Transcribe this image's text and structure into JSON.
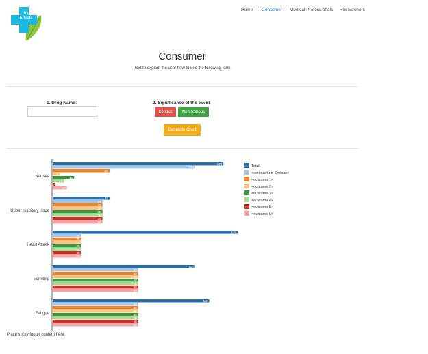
{
  "brand": {
    "logo_text_line1": "Rx",
    "logo_text_line2": "Effects",
    "accent_blue": "#1fb8e0",
    "accent_green": "#8cc63f"
  },
  "nav": {
    "items": [
      {
        "label": "Home",
        "active": false
      },
      {
        "label": "Consumer",
        "active": true
      },
      {
        "label": "Medical Professionals",
        "active": false
      },
      {
        "label": "Researchers",
        "active": false
      }
    ]
  },
  "page": {
    "title": "Consumer",
    "subtitle": "Text to explain the user how to use the following form"
  },
  "form": {
    "drug_label": "1. Drug Name:",
    "drug_value": "",
    "significance_label": "2. Significance of the event",
    "serious_label": "Serious",
    "nonserious_label": "Non-Serious",
    "generate_label": "Generate Chart",
    "colors": {
      "serious": "#d9534f",
      "nonserious": "#43a047",
      "generate": "#f0ad1f"
    }
  },
  "chart_data": {
    "type": "bar",
    "orientation": "horizontal",
    "categories": [
      "Nausea",
      "Upper respitory issue",
      "Heart Attack",
      "Vomiting",
      "Fatigue"
    ],
    "xlim": [
      0,
      130
    ],
    "legend_position": "right",
    "series": [
      {
        "name": "Total",
        "color": "#2b6fa8",
        "values": [
          120,
          40,
          130,
          100,
          110
        ]
      },
      {
        "name": "<serious/non-Serious>",
        "color": "#a8c5e8",
        "values": [
          100,
          35,
          20,
          60,
          60
        ]
      },
      {
        "name": "<outcome 1>",
        "color": "#f0821e",
        "values": [
          40,
          35,
          20,
          60,
          60
        ]
      },
      {
        "name": "<outcome 2>",
        "color": "#f7c48a",
        "values": [
          5,
          35,
          20,
          60,
          60
        ]
      },
      {
        "name": "<outcome 3>",
        "color": "#3a9a3a",
        "values": [
          15,
          35,
          20,
          60,
          60
        ]
      },
      {
        "name": "<outcome 4>",
        "color": "#a6dc8e",
        "values": [
          8,
          35,
          20,
          60,
          60
        ]
      },
      {
        "name": "<outcome 5>",
        "color": "#d42a2a",
        "values": [
          2,
          35,
          20,
          60,
          60
        ]
      },
      {
        "name": "<outcome 6>",
        "color": "#f5a3a3",
        "values": [
          10,
          35,
          20,
          60,
          60
        ]
      }
    ]
  },
  "footer": {
    "text": "Place sticky footer content here."
  }
}
